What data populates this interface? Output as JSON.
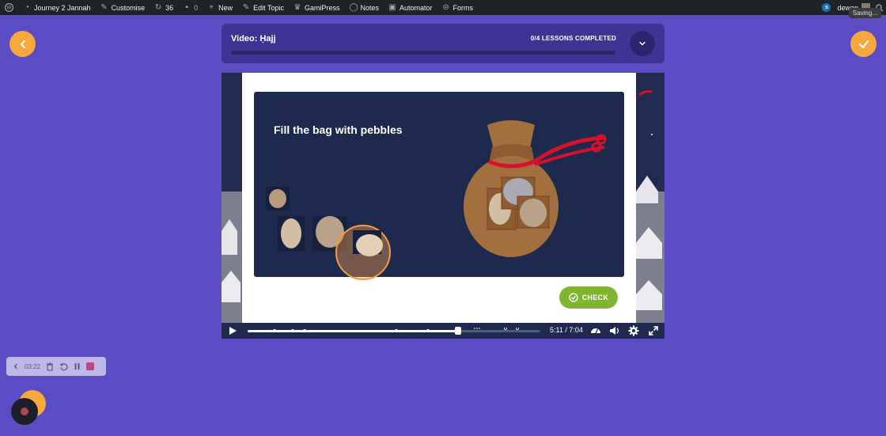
{
  "adminbar": {
    "site_name": "Journey 2 Jannah",
    "customise": "Customise",
    "updates_count": "36",
    "comments_count": "0",
    "new": "New",
    "edit_topic": "Edit Topic",
    "gamipress": "GamiPress",
    "notes": "Notes",
    "automator": "Automator",
    "forms": "Forms",
    "user": "dewan",
    "saving": "Saving..."
  },
  "lesson": {
    "title": "Video: Ḥajj",
    "progress_text": "0/4 LESSONS COMPLETED",
    "progress_fraction": 0
  },
  "slide": {
    "title": "Fill the bag with pebbles",
    "check_label": "CHECK"
  },
  "player": {
    "time": "5:11 / 7:04",
    "progress_fraction": 0.72
  },
  "recorder": {
    "timer": "03:22"
  },
  "colors": {
    "background": "#5b4cc4",
    "accent_orange": "#f6a83c",
    "check_green": "#7fb531",
    "panel_navy": "#1e2a4d"
  }
}
